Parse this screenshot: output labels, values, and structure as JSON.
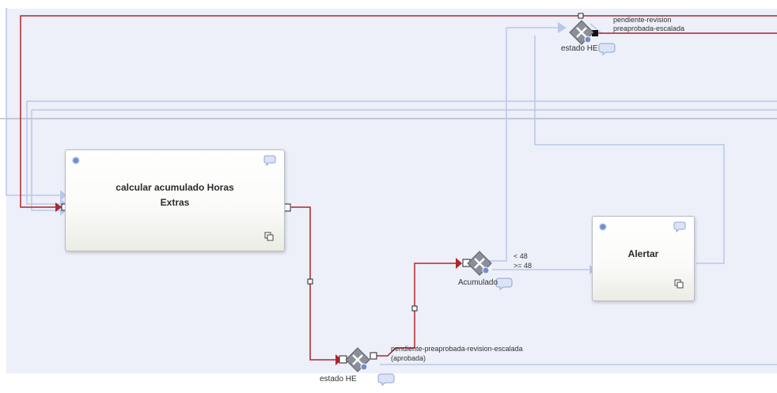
{
  "tasks": {
    "calcular": {
      "line1": "calcular acumulado Horas",
      "line2": "Extras"
    },
    "alertar": {
      "label": "Alertar"
    }
  },
  "gateways": {
    "estado_top": {
      "label": "estado HE",
      "cond1": "pendiente-revision",
      "cond2": "preaprobada-escalada"
    },
    "acumulado": {
      "label": "Acumulado",
      "cond1": "< 48",
      "cond2": ">= 48"
    },
    "estado_bottom": {
      "label": "estado HE",
      "cond1": "pendiente-preaprobada-revision-escalada",
      "cond2": "(aprobada)"
    }
  },
  "colors": {
    "canvas": "#edeff9",
    "flow_red": "#b0262a",
    "flow_blue": "#b9c8ea",
    "gear": "#6f8fd0"
  }
}
